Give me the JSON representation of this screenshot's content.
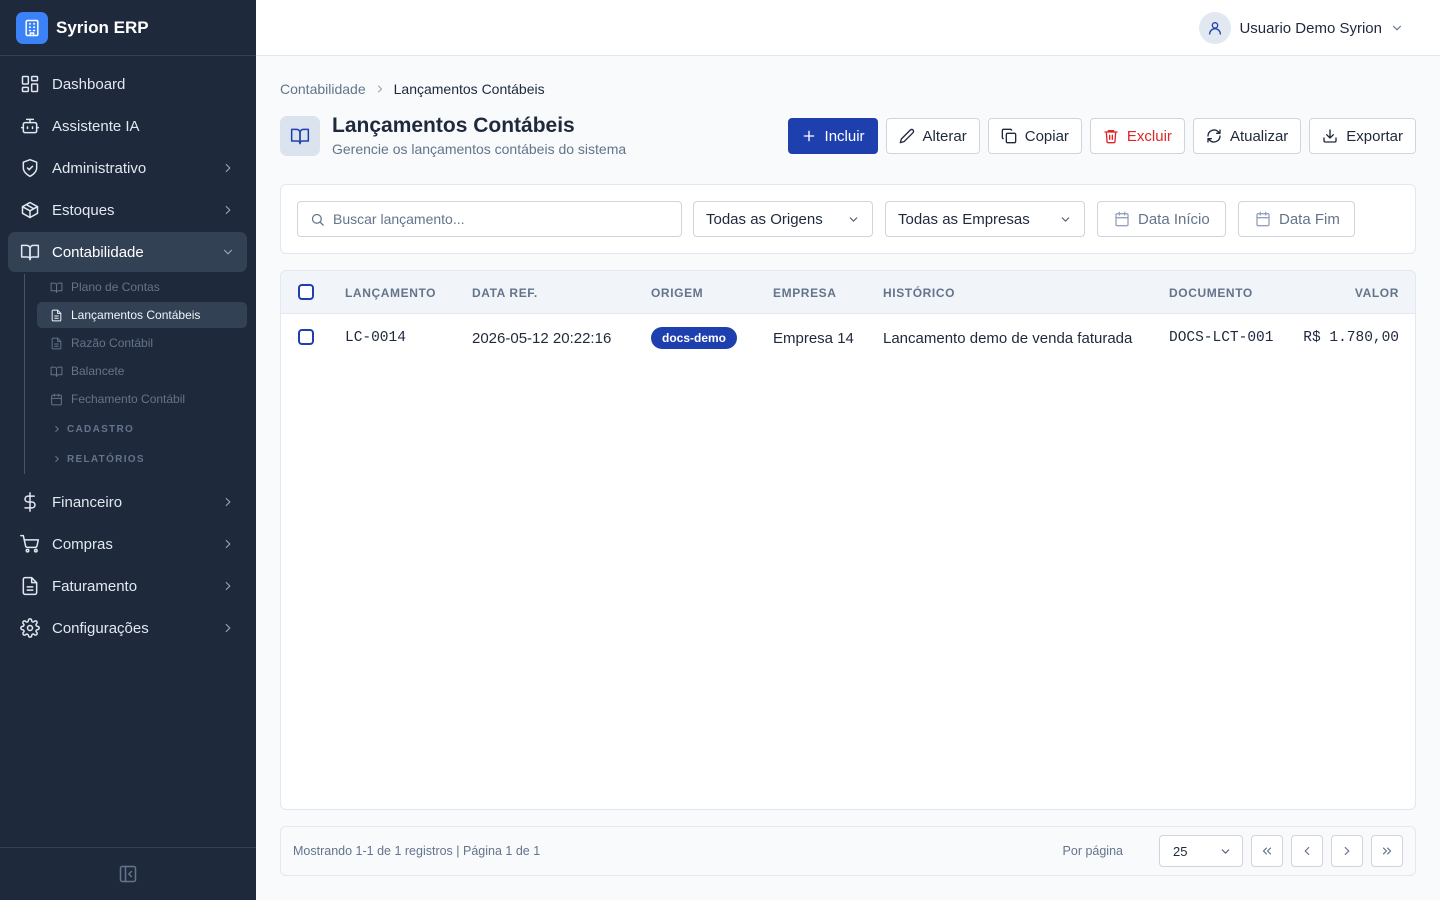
{
  "colors": {
    "sidebar_bg": "#1e293b",
    "accent": "#1e40af",
    "danger": "#dc2626",
    "page_bg": "#f8fafc"
  },
  "brand": {
    "name": "Syrion ERP",
    "logo_icon": "building-icon"
  },
  "sidebar": {
    "items": [
      {
        "label": "Dashboard",
        "icon": "dashboard-icon"
      },
      {
        "label": "Assistente IA",
        "icon": "bot-icon"
      },
      {
        "label": "Administrativo",
        "icon": "shield-icon"
      },
      {
        "label": "Estoques",
        "icon": "package-icon"
      },
      {
        "label": "Contabilidade",
        "icon": "book-open-icon",
        "expanded": true
      },
      {
        "label": "Financeiro",
        "icon": "dollar-icon"
      },
      {
        "label": "Compras",
        "icon": "cart-icon"
      },
      {
        "label": "Faturamento",
        "icon": "file-text-icon"
      },
      {
        "label": "Configurações",
        "icon": "gear-icon"
      }
    ],
    "submenu": [
      {
        "label": "Plano de Contas",
        "icon": "book-open-icon"
      },
      {
        "label": "Lançamentos Contábeis",
        "icon": "file-text-icon",
        "active": true
      },
      {
        "label": "Razão Contábil",
        "icon": "file-text-icon"
      },
      {
        "label": "Balancete",
        "icon": "book-open-icon"
      },
      {
        "label": "Fechamento Contábil",
        "icon": "calendar-icon"
      }
    ],
    "groups": [
      {
        "label": "CADASTRO"
      },
      {
        "label": "RELATÓRIOS"
      }
    ]
  },
  "topbar": {
    "user_name": "Usuario Demo Syrion"
  },
  "breadcrumb": {
    "parent": "Contabilidade",
    "current": "Lançamentos Contábeis"
  },
  "page": {
    "title": "Lançamentos Contábeis",
    "subtitle": "Gerencie os lançamentos contábeis do sistema"
  },
  "actions": {
    "include": "Incluir",
    "edit": "Alterar",
    "copy": "Copiar",
    "delete": "Excluir",
    "refresh": "Atualizar",
    "export": "Exportar"
  },
  "filters": {
    "search_placeholder": "Buscar lançamento...",
    "origin_selected": "Todas as Origens",
    "company_selected": "Todas as Empresas",
    "date_start": "Data Início",
    "date_end": "Data Fim"
  },
  "table": {
    "columns": {
      "lancamento": "LANÇAMENTO",
      "data_ref": "DATA REF.",
      "origem": "ORIGEM",
      "empresa": "EMPRESA",
      "historico": "HISTÓRICO",
      "documento": "DOCUMENTO",
      "valor": "VALOR"
    },
    "rows": [
      {
        "lancamento": "LC-0014",
        "data_ref": "2026-05-12 20:22:16",
        "origem": "docs-demo",
        "empresa": "Empresa 14",
        "historico": "Lancamento demo de venda faturada",
        "documento": "DOCS-LCT-001",
        "valor": "R$ 1.780,00"
      }
    ]
  },
  "pagination": {
    "info": "Mostrando 1-1 de 1 registros | Página 1 de 1",
    "per_page_label": "Por página",
    "per_page_value": "25"
  }
}
